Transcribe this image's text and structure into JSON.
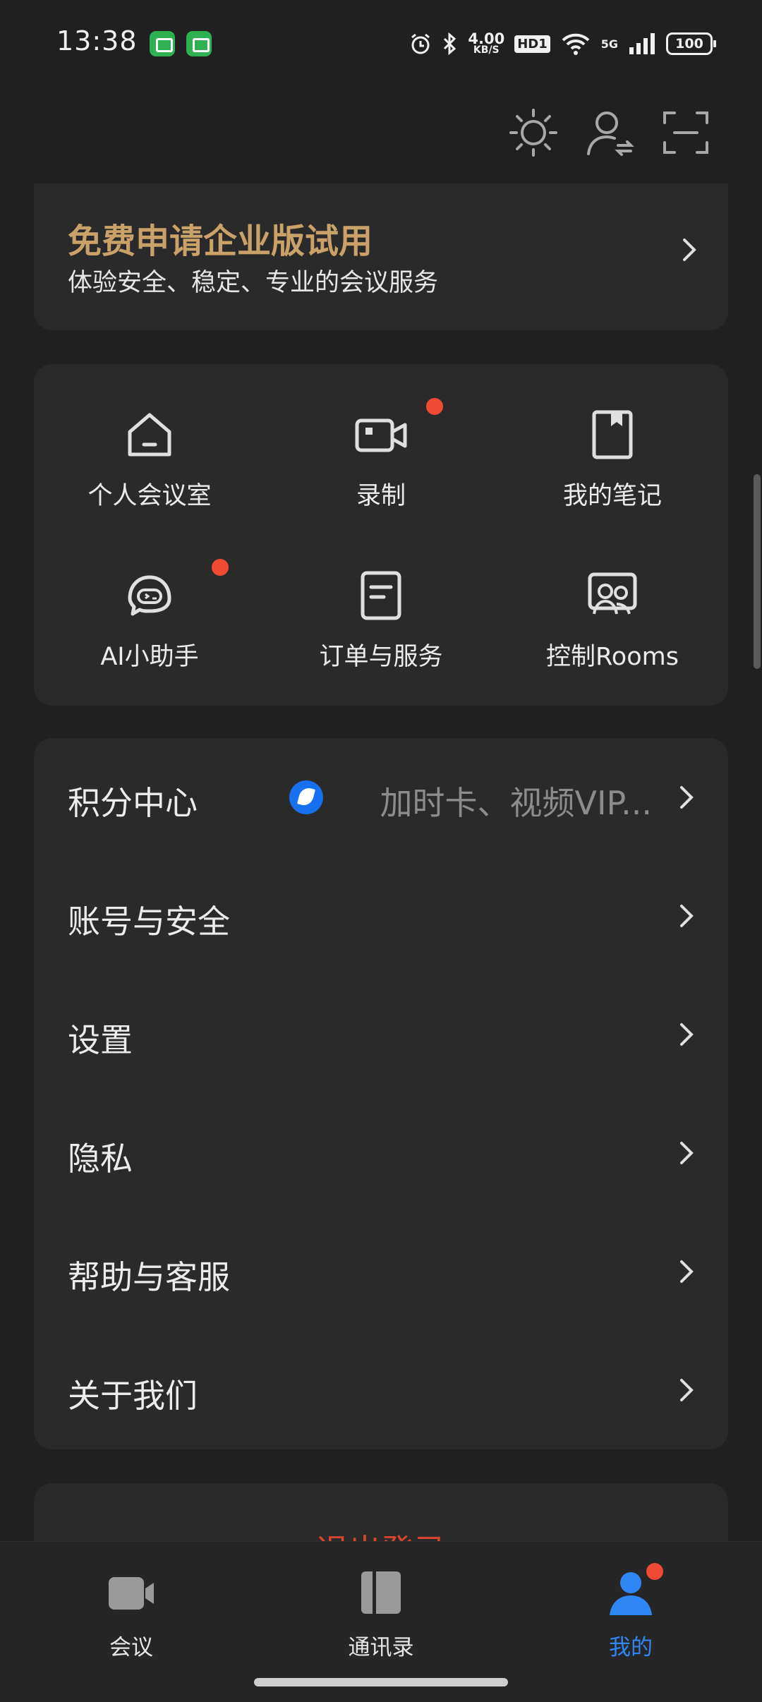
{
  "status_bar": {
    "time": "13:38",
    "net_speed": "4.00",
    "net_unit": "KB/S",
    "hd": "HD1",
    "network": "5G",
    "battery": "100"
  },
  "promo": {
    "title": "免费申请企业版试用",
    "subtitle": "体验安全、稳定、专业的会议服务"
  },
  "grid": {
    "items": [
      {
        "label": "个人会议室",
        "icon": "home-icon"
      },
      {
        "label": "录制",
        "icon": "video-record-icon"
      },
      {
        "label": "我的笔记",
        "icon": "note-icon"
      },
      {
        "label": "AI小助手",
        "icon": "ai-robot-icon"
      },
      {
        "label": "订单与服务",
        "icon": "order-icon"
      },
      {
        "label": "控制Rooms",
        "icon": "rooms-icon"
      }
    ]
  },
  "menu": {
    "items": [
      {
        "label": "积分中心",
        "extra": "加时卡、视频VIP..."
      },
      {
        "label": "账号与安全"
      },
      {
        "label": "设置"
      },
      {
        "label": "隐私"
      },
      {
        "label": "帮助与客服"
      },
      {
        "label": "关于我们"
      }
    ]
  },
  "logout": {
    "label": "退出登录"
  },
  "bottom_nav": {
    "items": [
      {
        "label": "会议",
        "icon": "meeting-video-icon"
      },
      {
        "label": "通讯录",
        "icon": "contacts-book-icon"
      },
      {
        "label": "我的",
        "icon": "profile-icon",
        "active": true
      }
    ]
  },
  "colors": {
    "accent": "#2f87f5",
    "promo_title": "#c8a268",
    "danger": "#d9442e",
    "badge_red": "#f04a35"
  }
}
